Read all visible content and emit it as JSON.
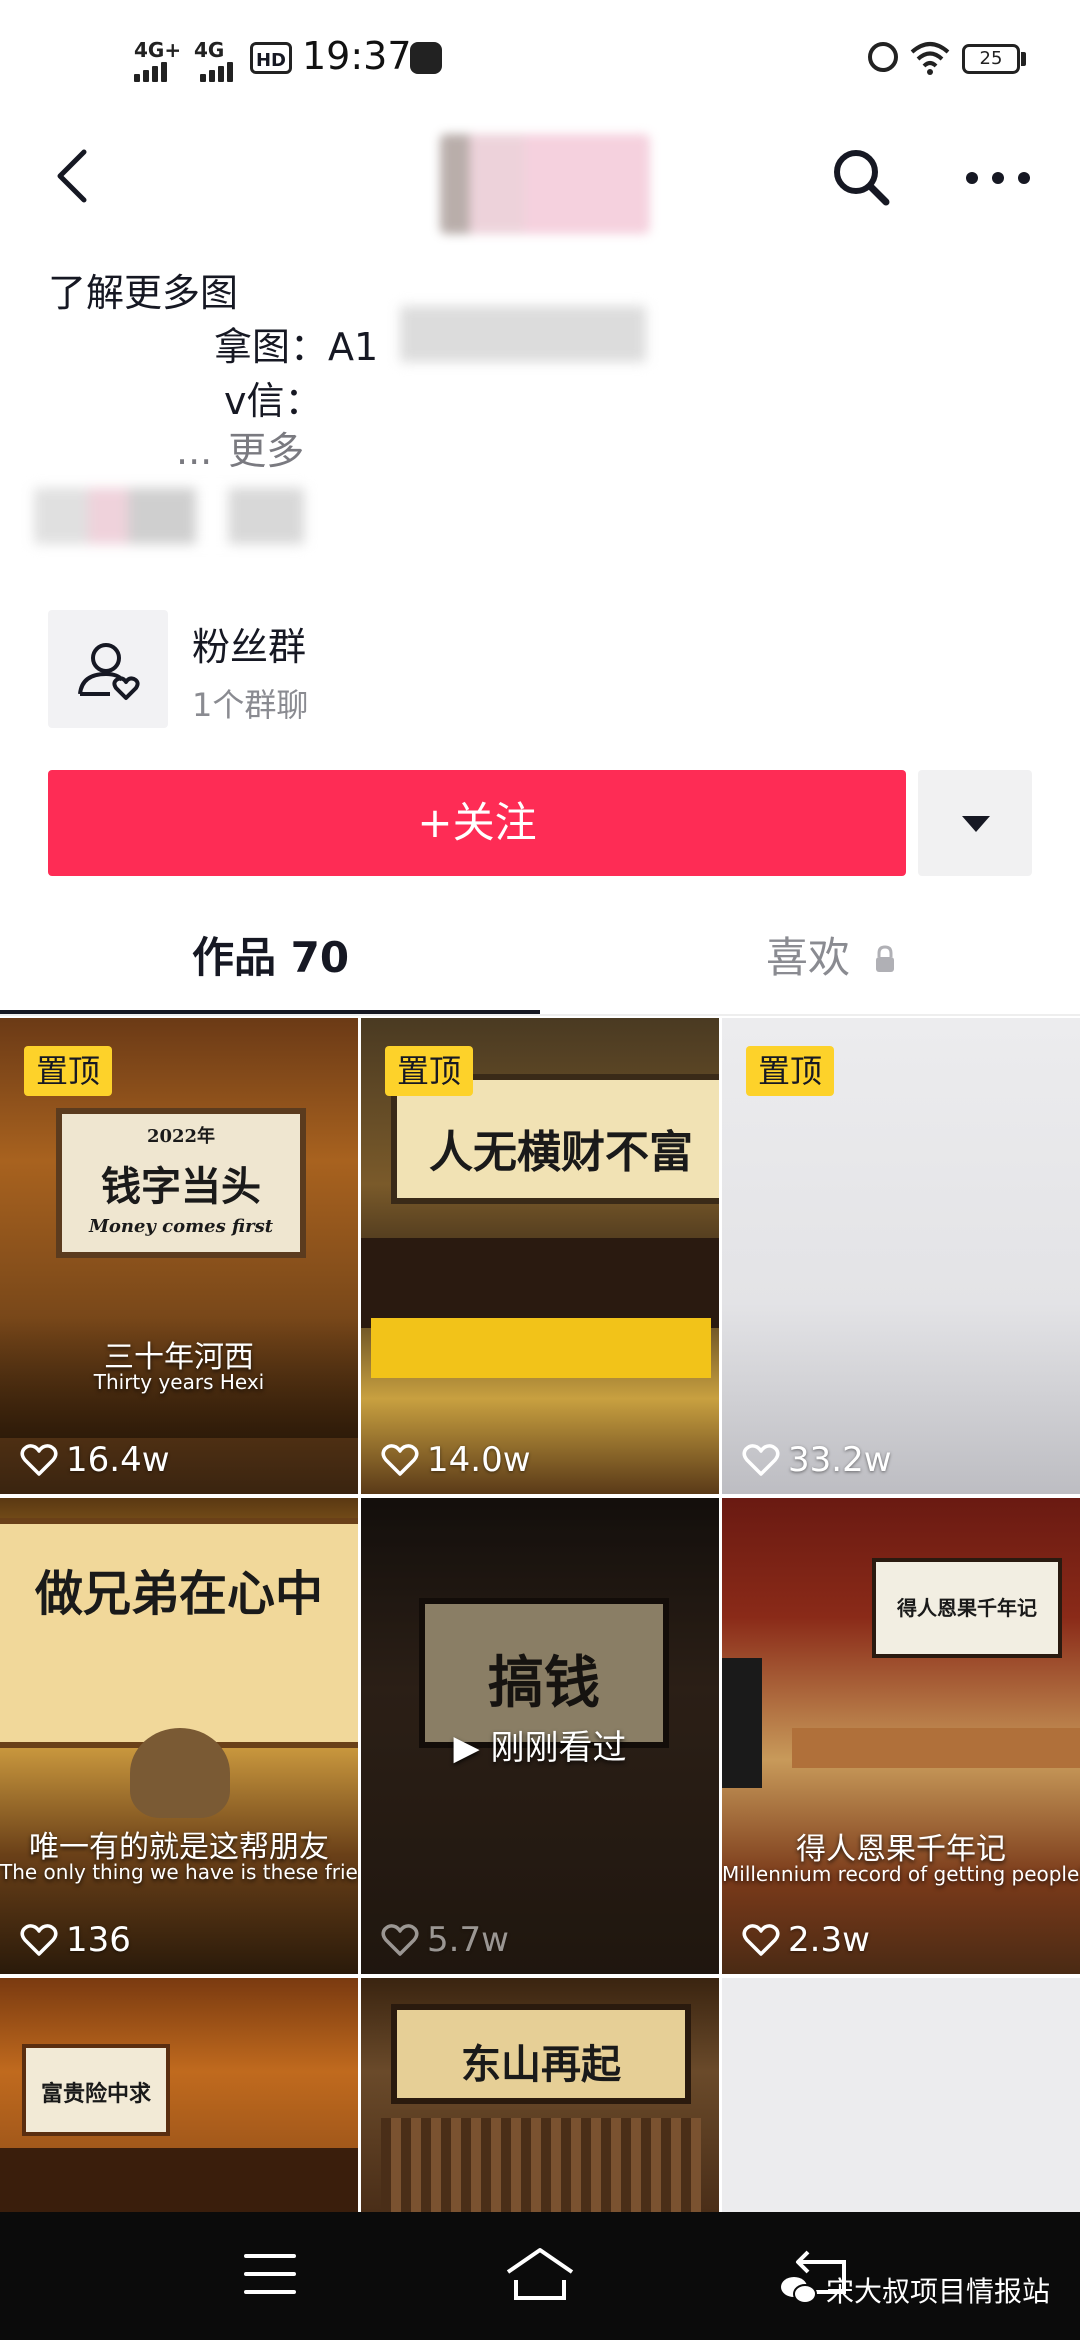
{
  "status_bar": {
    "network_1": "4G+",
    "network_2": "4G",
    "hd": "HD",
    "time": "19:37",
    "battery": "25"
  },
  "header": {
    "title": "",
    "back_icon": "chevron-left-icon",
    "search_icon": "search-icon",
    "more_icon": "more-horizontal-icon"
  },
  "bio": {
    "line1": "了解更多图",
    "line2": "拿图：A1",
    "line3": "v信：",
    "ellipsis": "...",
    "more": "更多"
  },
  "fan_group": {
    "title": "粉丝群",
    "subtitle": "1个群聊",
    "icon": "fan-group-icon"
  },
  "actions": {
    "follow": "+关注",
    "dropdown_icon": "caret-down-icon"
  },
  "tabs": {
    "works": "作品 70",
    "likes": "喜欢",
    "lock_icon": "lock-icon"
  },
  "videos": [
    {
      "pinned": "置顶",
      "likes": "16.4w",
      "caption_cn": "三十年河西",
      "caption_en": "Thirty years Hexi",
      "plaque_year": "2022年",
      "plaque_cn": "钱字当头",
      "plaque_en": "Money comes first"
    },
    {
      "pinned": "置顶",
      "likes": "14.0w",
      "plaque_cn": "人无横财不富"
    },
    {
      "pinned": "置顶",
      "likes": "33.2w"
    },
    {
      "likes": "136",
      "caption_cn": "唯一有的就是这帮朋友",
      "caption_en": "The only thing we have is these friends",
      "plaque_cn": "做兄弟在心中"
    },
    {
      "likes": "5.7w",
      "plaque_cn": "搞钱",
      "seen": "刚刚看过"
    },
    {
      "likes": "2.3w",
      "caption_cn": "得人恩果千年记",
      "caption_en": "Millennium record of getting people's favor",
      "plaque_cn": "得人恩果千年记"
    },
    {
      "plaque_cn": "富贵险中求"
    },
    {
      "plaque_cn": "东山再起"
    }
  ],
  "watermark": "宋大叔项目情报站",
  "nav": {
    "menu_icon": "menu-icon",
    "home_icon": "home-icon",
    "back_icon": "back-arrow-icon"
  }
}
